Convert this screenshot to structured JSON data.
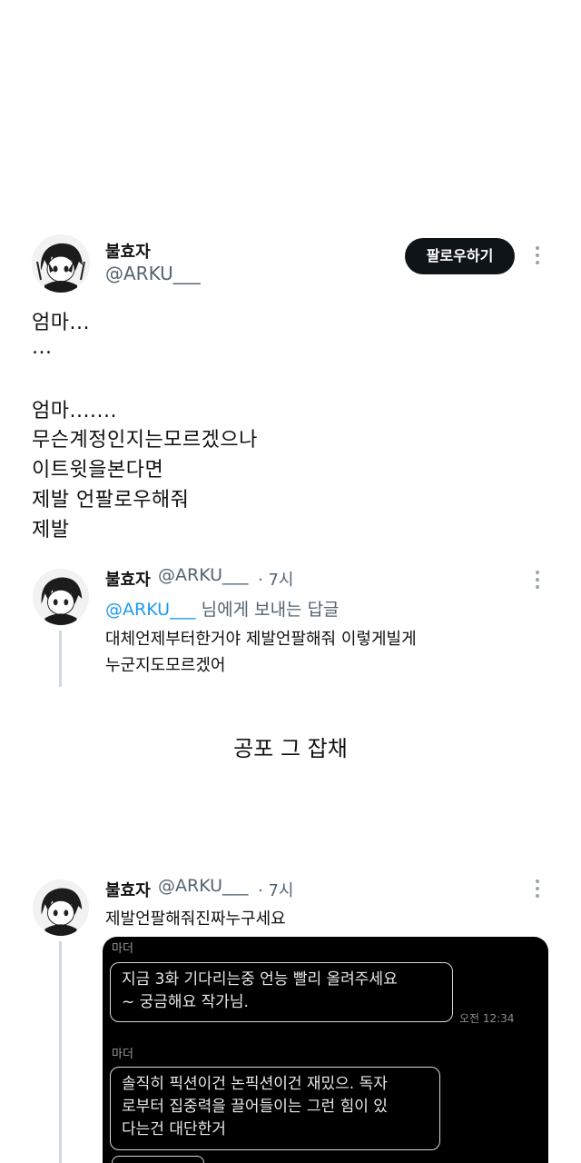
{
  "tweet": {
    "display_name": "불효자",
    "handle": "@ARKU___",
    "follow_label": "팔로우하기",
    "body_lines": [
      "엄마...",
      "...",
      "",
      "엄마.......",
      "무슨계정인지는모르겠으나",
      "이트윗을본다면",
      "제발 언팔로우해줘",
      "제발"
    ]
  },
  "reply1": {
    "display_name": "불효자",
    "handle": "@ARKU___",
    "time": "· 7시",
    "replying_mention": "@ARKU___",
    "replying_suffix": "님에게 보내는 답글",
    "text_lines": [
      "대체언제부터한거야 제발언팔해줘 이렇게빌게",
      "누군지도모르겠어"
    ]
  },
  "caption": "공포 그 잡채",
  "reply2": {
    "display_name": "불효자",
    "handle": "@ARKU___",
    "time": "· 7시",
    "text": "제발언팔해줘진짜누구세요"
  },
  "chat": {
    "messages": [
      {
        "sender": "마더",
        "text": "지금 3화 기다리는중 언능 빨리 올려주세요\n~ 궁금해요 작가님.",
        "time": "오전 12:34"
      },
      {
        "sender": "마더",
        "text": "솔직히 픽션이건 논픽션이건 재밌으. 독자\n로부터 집중력을 끌어들이는 그런 힘이 있\n다는건 대단한거",
        "time": ""
      }
    ]
  },
  "icons": {
    "more": "more-vertical-icon",
    "avatar": "anime-avatar-icon"
  },
  "colors": {
    "follow_bg": "#0f1419",
    "mention": "#1d9bf0",
    "secondary_text": "#536471",
    "chat_bg": "#000000"
  }
}
